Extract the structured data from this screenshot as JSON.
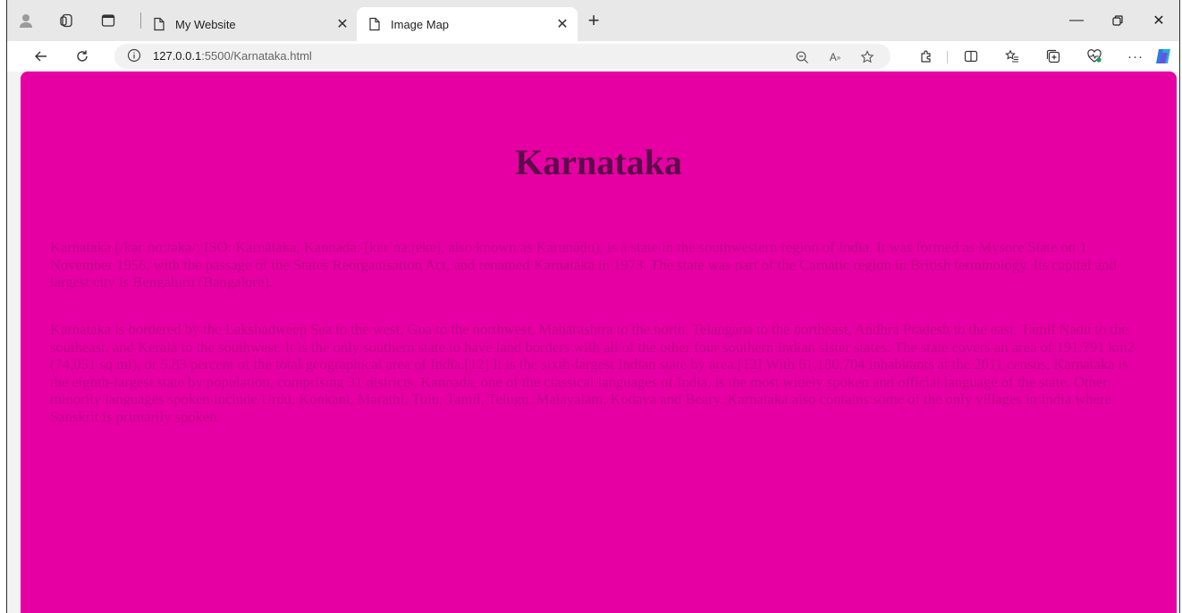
{
  "browser": {
    "tabs": [
      {
        "label": "My Website"
      },
      {
        "label": "Image Map"
      }
    ],
    "address": {
      "host": "127.0.0.1",
      "path": ":5500/Karnataka.html"
    },
    "icons": {
      "profile": "profile-icon",
      "workspaces": "workspaces-icon",
      "tab_actions": "tab-actions-icon",
      "page": "page-icon",
      "close": "close-icon",
      "new_tab": "plus-icon",
      "minimize": "minimize-icon",
      "restore": "restore-icon",
      "back": "back-arrow-icon",
      "refresh": "refresh-icon",
      "info": "info-icon",
      "zoom": "zoom-out-icon",
      "read_aloud": "read-aloud-icon",
      "favorite": "star-icon",
      "extensions": "extensions-icon",
      "split_screen": "split-screen-icon",
      "favorites": "favorites-icon",
      "collections": "collections-icon",
      "performance": "heart-pulse-icon",
      "more": "more-icon",
      "copilot": "copilot-icon"
    }
  },
  "page": {
    "background": "#e600a3",
    "heading_color": "#5c0a4a",
    "text_color": "#c0048b",
    "title": "Karnataka",
    "paragraphs": [
      "Karnataka (/kərˈnɑːtəkə/; ISO: Karnāṭaka, Kannada: [kɐrˈnaːʈɐkɐ], also known as Karunāḍu), is a state in the southwestern region of India. It was formed as Mysore State on 1 November 1956, with the passage of the States Reorganisation Act, and renamed Karnataka in 1973. The state was part of the Carnatic region in British terminology. Its capital and largest city is Bengaluru (Bangalore).",
      "Karnataka is bordered by the Lakshadweep Sea to the west, Goa to the northwest, Maharashtra to the north, Telangana to the northeast, Andhra Pradesh to the east, Tamil Nadu to the southeast, and Kerala to the southwest. It is the only southern state to have land borders with all of the other four southern Indian sister states. The state covers an area of 191,791 km2 (74,051 sq mi), or 5.83 percent of the total geographical area of India.[12] It is the sixth-largest Indian state by area.[12] With 61,130,704 inhabitants at the 2011 census, Karnataka is the eighth-largest state by population, comprising 31 districts. Kannada, one of the classical languages of India, is the most widely spoken and official language of the state. Other minority languages spoken include Urdu, Konkani, Marathi, Tulu, Tamil, Telugu, Malayalam, Kodava and Beary. Karnataka also contains some of the only villages in India where Sanskrit is primarily spoken."
    ]
  }
}
